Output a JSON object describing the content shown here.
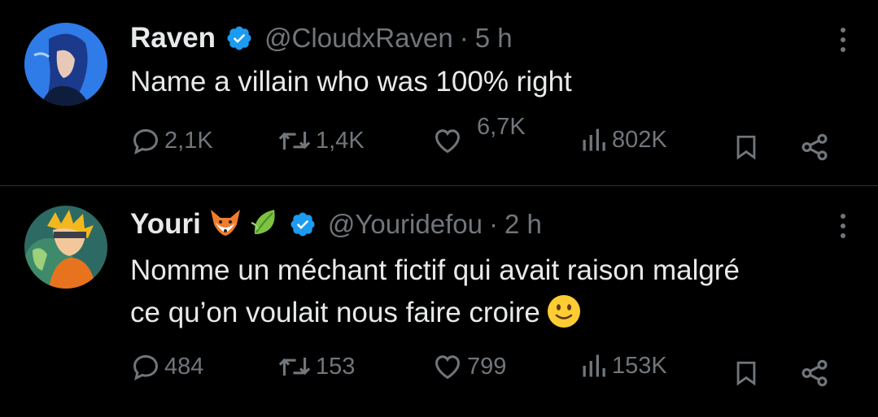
{
  "tweets": [
    {
      "name": "Raven",
      "handle": "@CloudxRaven",
      "separator": "·",
      "time": "5 h",
      "text": "Name a villain who was 100% right",
      "stats": {
        "replies": "2,1K",
        "retweets": "1,4K",
        "likes": "6,7K",
        "views": "802K"
      }
    },
    {
      "name": "Youri",
      "name_emojis": [
        "🦊",
        "🍃"
      ],
      "handle": "@Youridefou",
      "separator": "·",
      "time": "2 h",
      "text_line1": "Nomme un méchant fictif qui avait raison malgré",
      "text_line2": "ce qu’on voulait nous faire croire",
      "stats": {
        "replies": "484",
        "retweets": "153",
        "likes": "799",
        "views": "153K"
      }
    }
  ],
  "colors": {
    "background": "#000000",
    "text": "#e7e9ea",
    "muted": "#71767b",
    "verified": "#1d9bf0",
    "divider": "#2f3336"
  },
  "icons": [
    "verified-badge-icon",
    "more-icon",
    "reply-icon",
    "retweet-icon",
    "like-icon",
    "views-icon",
    "bookmark-icon",
    "share-icon",
    "slightly-smiling-face-emoji"
  ]
}
